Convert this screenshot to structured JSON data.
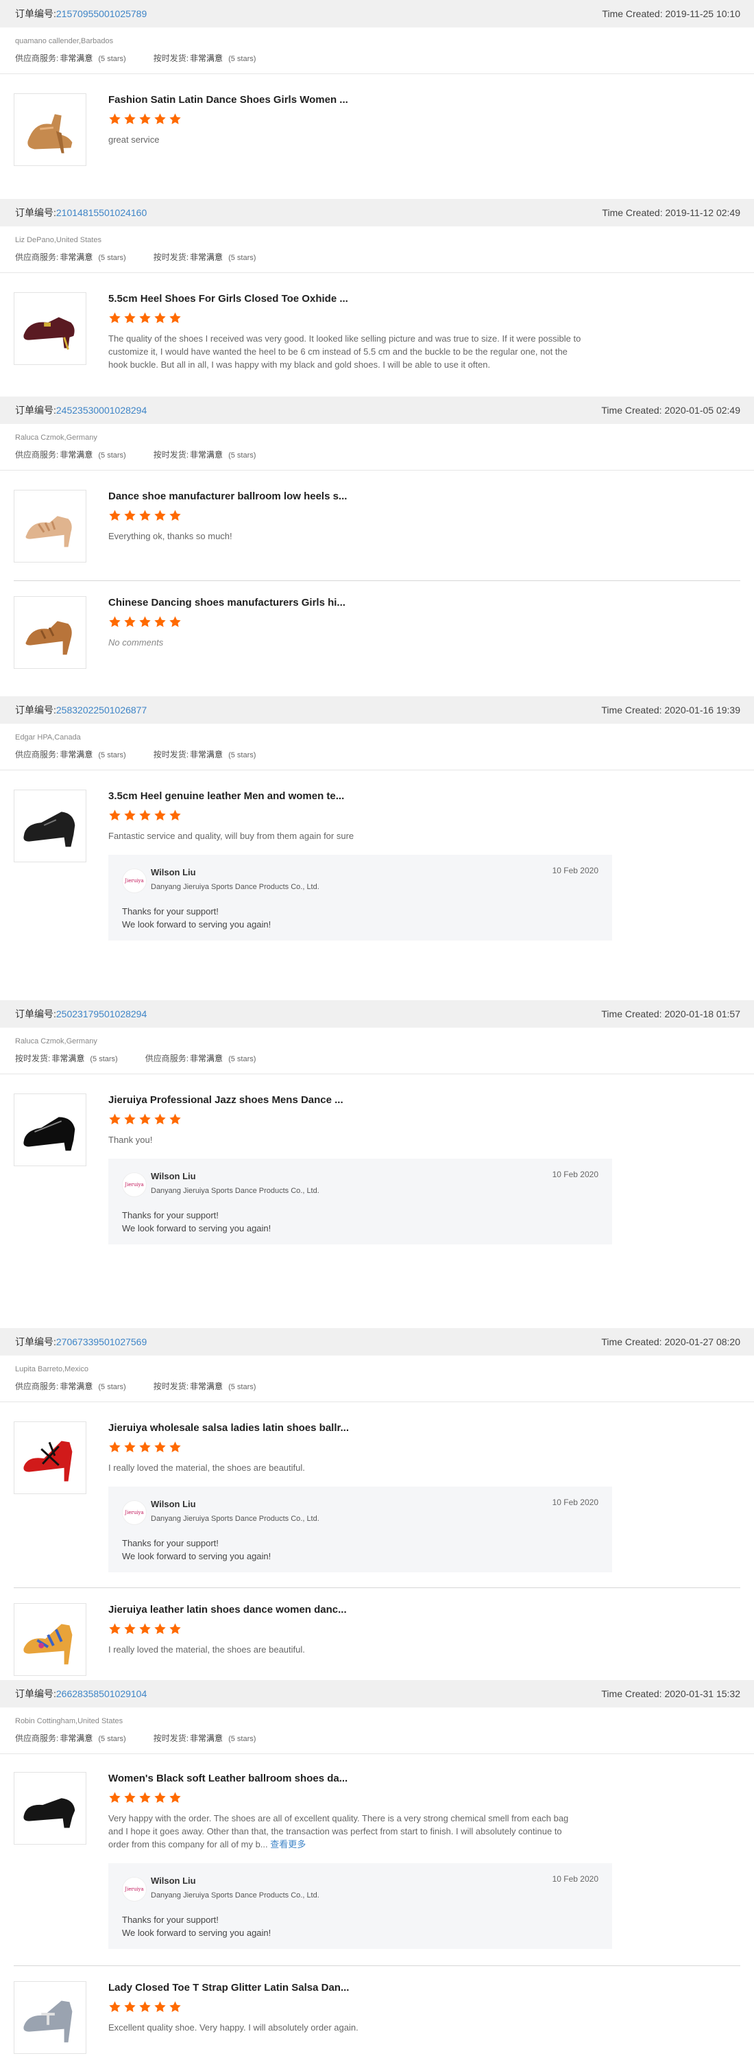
{
  "labels": {
    "order_no": "订单编号:",
    "supplier_service": "供应商服务:",
    "on_time": "按时发货:",
    "very_satisfied": "非常满意",
    "five_stars": "(5 stars)",
    "time_created": "Time Created:",
    "no_comments": "No comments",
    "see_more": "查看更多",
    "reply_name": "Wilson Liu",
    "reply_company": "Danyang Jieruiya Sports Dance Products Co., Ltd.",
    "reply_date": "10 Feb 2020",
    "reply_line1": "Thanks for your support!",
    "reply_line2": "We look forward to serving you again!",
    "reply_logo": "Jieruiya"
  },
  "colors": {
    "star": "#ff6a00",
    "link": "#3f85c7",
    "header_bg": "#f0f0f0"
  },
  "orders": [
    {
      "number": "21570955001025789",
      "time": "Time Created: 2019-11-25 10:10",
      "buyer": "quamano callender,Barbados",
      "r1_label": "供应商服务:",
      "r2_label": "按时发货:",
      "items": [
        {
          "title": "Fashion Satin Latin Dance Shoes Girls Women ...",
          "review": "great service"
        }
      ]
    },
    {
      "number": "21014815501024160",
      "time": "Time Created: 2019-11-12 02:49",
      "buyer": "Liz DePano,United States",
      "r1_label": "供应商服务:",
      "r2_label": "按时发货:",
      "items": [
        {
          "title": "5.5cm Heel Shoes For Girls Closed Toe Oxhide ...",
          "review": "The quality of the shoes I received was very good. It looked like selling picture and was true to size. If it were possible to customize it, I would have wanted the heel to be 6 cm instead of 5.5 cm and the buckle to be the regular one, not the hook buckle. But all in all, I was happy with my black and gold shoes. I will be able to use it often."
        }
      ]
    },
    {
      "number": "24523530001028294",
      "time": "Time Created: 2020-01-05 02:49",
      "buyer": "Raluca Czmok,Germany",
      "r1_label": "供应商服务:",
      "r2_label": "按时发货:",
      "items": [
        {
          "title": "Dance shoe manufacturer ballroom low heels s...",
          "review": "Everything ok, thanks so much!"
        },
        {
          "title": "Chinese Dancing shoes manufacturers Girls hi...",
          "review": "No comments"
        }
      ]
    },
    {
      "number": "25832022501026877",
      "time": "Time Created: 2020-01-16 19:39",
      "buyer": "Edgar HPA,Canada",
      "r1_label": "供应商服务:",
      "r2_label": "按时发货:",
      "items": [
        {
          "title": "3.5cm Heel genuine leather Men and women te...",
          "review": "Fantastic service and quality, will buy from them again for sure"
        }
      ]
    },
    {
      "number": "25023179501028294",
      "time": "Time Created: 2020-01-18 01:57",
      "buyer": "Raluca Czmok,Germany",
      "r1_label": "按时发货:",
      "r2_label": "供应商服务:",
      "items": [
        {
          "title": "Jieruiya Professional Jazz shoes Mens Dance ...",
          "review": "Thank you!"
        }
      ]
    },
    {
      "number": "27067339501027569",
      "time": "Time Created: 2020-01-27 08:20",
      "buyer": "Lupita Barreto,Mexico",
      "r1_label": "供应商服务:",
      "r2_label": "按时发货:",
      "items": [
        {
          "title": "Jieruiya wholesale salsa ladies latin shoes ballr...",
          "review": "I really loved the material, the shoes are beautiful."
        },
        {
          "title": "Jieruiya leather latin shoes dance women danc...",
          "review": "I really loved the material, the shoes are beautiful."
        }
      ]
    },
    {
      "number": "26628358501029104",
      "time": "Time Created: 2020-01-31 15:32",
      "buyer": "Robin Cottingham,United States",
      "r1_label": "供应商服务:",
      "r2_label": "按时发货:",
      "items": [
        {
          "title": "Women's Black soft Leather ballroom shoes da...",
          "review": "Very happy with the order. The shoes are all of excellent quality. There is a very strong chemical smell from each bag and I hope it goes away. Other than that, the transaction was perfect from start to finish. I will absolutely continue to order from this company for all of my b... "
        },
        {
          "title": "Lady Closed Toe T Strap Glitter Latin Salsa Dan...",
          "review": "Excellent quality shoe. Very happy. I will absolutely order again."
        }
      ]
    }
  ]
}
